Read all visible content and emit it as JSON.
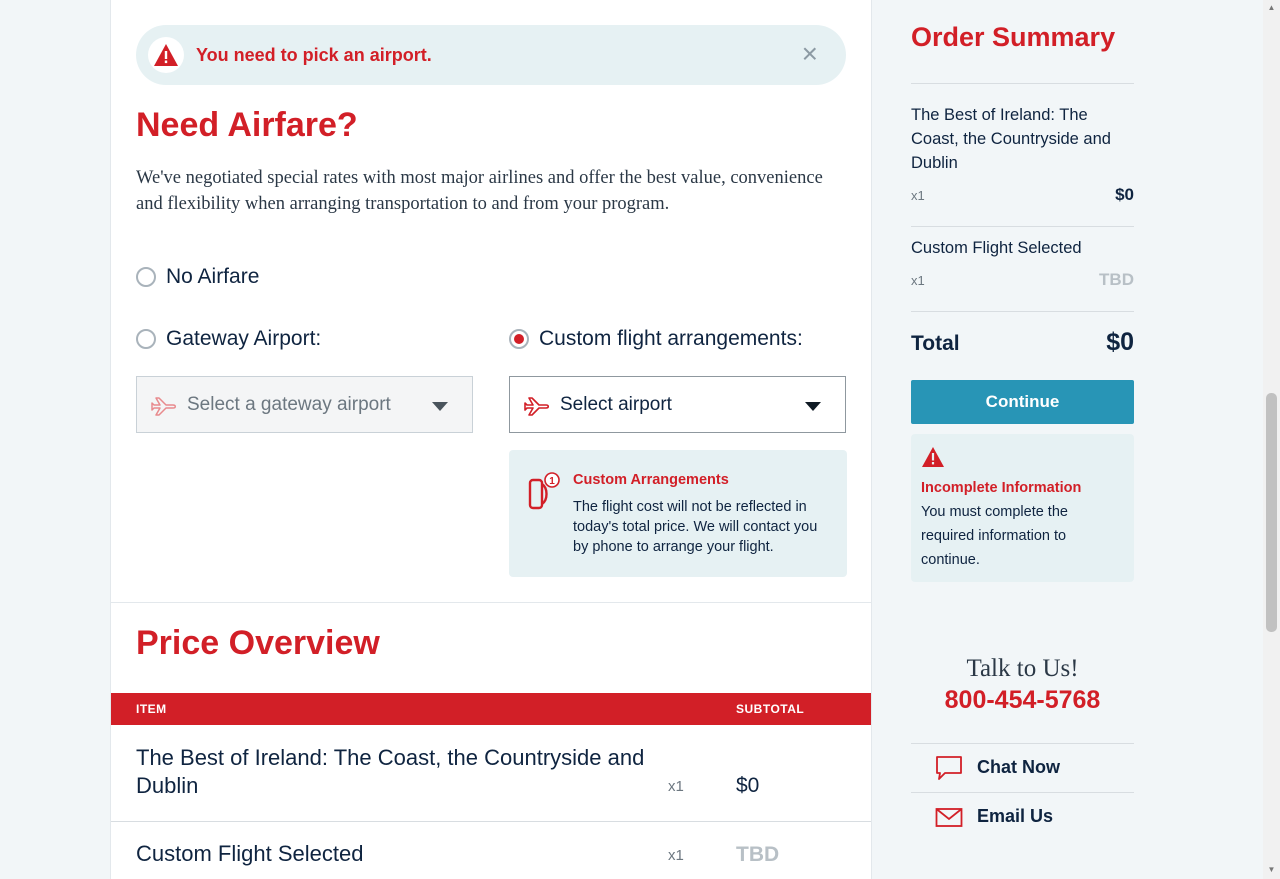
{
  "alert": {
    "message": "You need to pick an airport.",
    "close_glyph": "×",
    "icon": "warning-triangle-icon"
  },
  "airfare": {
    "heading": "Need Airfare?",
    "intro": "We've negotiated special rates with most major airlines and offer the best value, convenience and flexibility when arranging transportation to and from your program.",
    "options": {
      "no_airfare": "No Airfare",
      "gateway": "Gateway Airport:",
      "custom": "Custom flight arrangements:"
    },
    "selected_option": "custom",
    "gateway_select_placeholder": "Select a gateway airport",
    "custom_select_placeholder": "Select airport",
    "info": {
      "title": "Custom Arrangements",
      "body": "The flight cost will not be reflected in today's total price. We will contact you by phone to arrange your flight."
    }
  },
  "price_overview": {
    "heading": "Price Overview",
    "columns": {
      "item": "ITEM",
      "subtotal": "SUBTOTAL"
    },
    "rows": [
      {
        "name": "The Best of Ireland: The Coast, the Countryside and Dublin",
        "qty": "x1",
        "subtotal": "$0"
      },
      {
        "name": "Custom Flight Selected",
        "qty": "x1",
        "subtotal": "TBD"
      }
    ]
  },
  "order_summary": {
    "title": "Order Summary",
    "items": [
      {
        "name": "The Best of Ireland: The Coast, the Countryside and Dublin",
        "qty": "x1",
        "price": "$0"
      },
      {
        "name": "Custom Flight Selected",
        "qty": "x1",
        "price": "TBD"
      }
    ],
    "total_label": "Total",
    "total_value": "$0",
    "continue_label": "Continue",
    "incomplete": {
      "title": "Incomplete Information",
      "body": "You must complete the required information to continue."
    }
  },
  "contact": {
    "talk": "Talk to Us!",
    "phone": "800-454-5768",
    "chat": "Chat Now",
    "email": "Email Us"
  },
  "colors": {
    "brand_red": "#d21f27",
    "navy_text": "#0f2440",
    "continue_blue": "#2895b6",
    "panel_bg": "#e6f1f3",
    "muted_tbd": "#b8c0c6"
  }
}
